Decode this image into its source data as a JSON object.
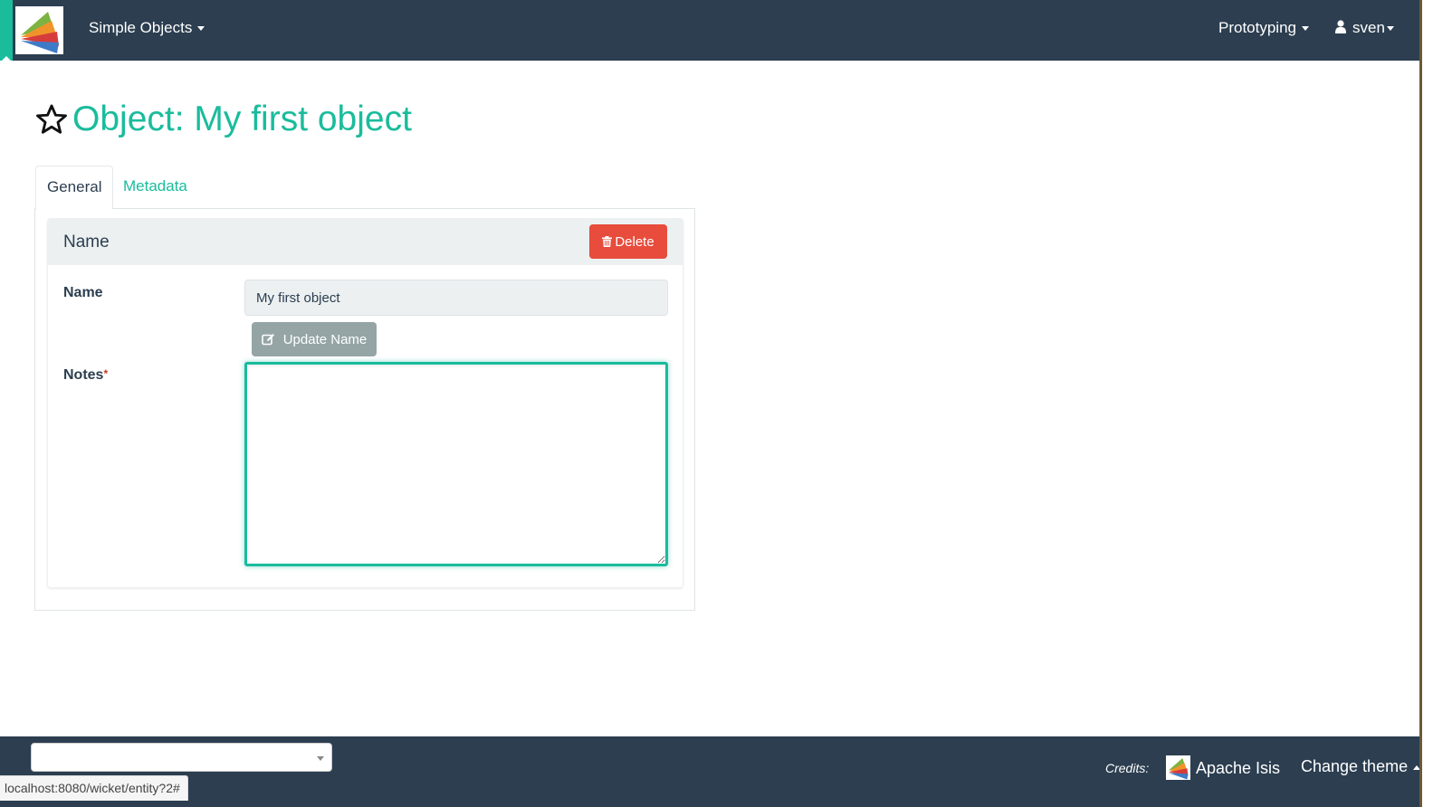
{
  "navbar": {
    "app_menu_label": "Simple Objects",
    "right_menu_label": "Prototyping",
    "user_label": "sven"
  },
  "page": {
    "title": "Object: My first object"
  },
  "tabs": [
    {
      "label": "General",
      "active": true
    },
    {
      "label": "Metadata",
      "active": false
    }
  ],
  "panel": {
    "title": "Name",
    "delete_label": "Delete",
    "fields": {
      "name_label": "Name",
      "name_value": "My first object",
      "update_label": "Update Name",
      "notes_label": "Notes",
      "notes_required": "*",
      "notes_value": ""
    }
  },
  "footer": {
    "select_value": "",
    "credits_label": "Credits:",
    "credits_link": "Apache Isis",
    "change_theme_label": "Change theme"
  },
  "status_bar": {
    "url": "localhost:8080/wicket/entity?2#"
  },
  "colors": {
    "navbar": "#2c3e50",
    "accent": "#1abc9c",
    "danger": "#e74c3c",
    "muted_button": "#95a5a6"
  }
}
